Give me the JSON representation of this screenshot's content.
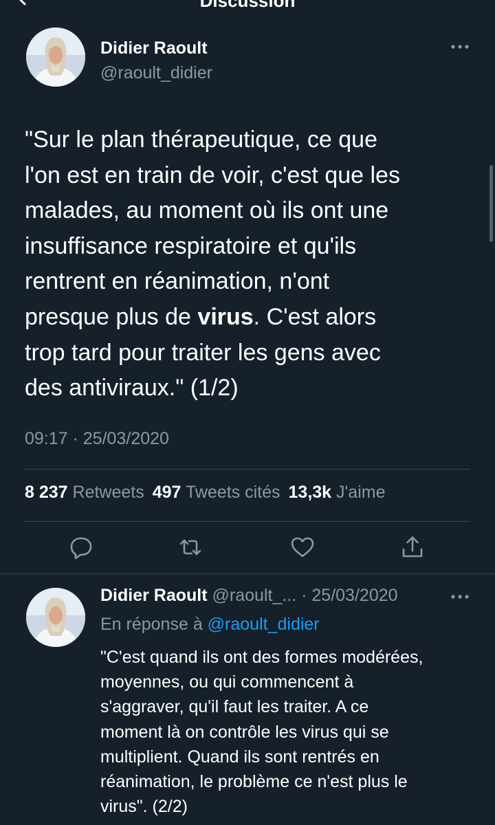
{
  "screen": {
    "title": "Discussion"
  },
  "tweet": {
    "author_name": "Didier Raoult",
    "author_handle": "@raoult_didier",
    "text_lines": [
      "\"Sur le plan thérapeutique, ce que",
      "l'on est en train de voir, c'est que les",
      "malades, au moment où ils ont une",
      "insuffisance respiratoire et qu'ils",
      "rentrent en réanimation, n'ont"
    ],
    "text_line6_before": "presque plus de ",
    "text_line6_bold": "virus",
    "text_line6_after": ". C'est alors",
    "text_lines_end": [
      "trop tard pour traiter les gens avec",
      "des antiviraux.\" (1/2)"
    ],
    "timestamp": "09:17 · 25/03/2020",
    "stats": {
      "retweets_count": "8 237",
      "retweets_label": "Retweets",
      "quotes_count": "497",
      "quotes_label": "Tweets cités",
      "likes_count": "13,3k",
      "likes_label": "J'aime"
    }
  },
  "reply": {
    "author_name": "Didier Raoult",
    "meta": "@raoult_... · 25/03/2020",
    "in_reply_to_label": "En réponse à",
    "in_reply_to_handle": "@raoult_didier",
    "text_lines": [
      "\"C'est quand ils ont des formes modérées,",
      "moyennes, ou qui commencent à",
      "s'aggraver, qu'il faut les traiter. A ce",
      "moment là on contrôle les virus qui se",
      "multiplient. Quand ils sont rentrés en",
      "réanimation, le problème ce n'est plus le",
      "virus\". (2/2)"
    ]
  },
  "icons": {
    "back": "back-arrow-icon",
    "more": "more-options-icon",
    "reply": "reply-icon",
    "retweet": "retweet-icon",
    "like": "like-icon",
    "share": "share-icon"
  },
  "colors": {
    "background": "#15202b",
    "text_primary": "#ffffff",
    "text_secondary": "#8b98a5",
    "divider": "#38444d",
    "accent": "#1d9bf0"
  }
}
